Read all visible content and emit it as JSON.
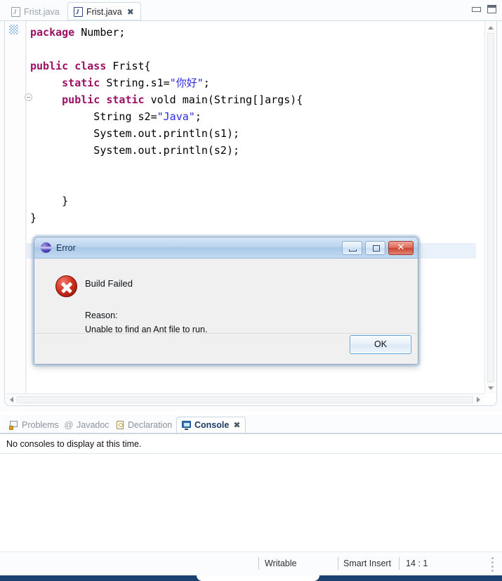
{
  "editor": {
    "tabs": [
      {
        "label": "Frist.java",
        "active": false,
        "icon": "java-file-icon"
      },
      {
        "label": "Frist.java",
        "active": true,
        "icon": "java-file-icon",
        "close": "✖"
      }
    ],
    "view_buttons": [
      {
        "name": "minimize-view",
        "icon": "minimize-icon"
      },
      {
        "name": "maximize-view",
        "icon": "maximize-icon"
      }
    ],
    "code_lines": [
      [
        {
          "t": "package ",
          "c": "kw"
        },
        {
          "t": "Number;",
          "c": "plain"
        }
      ],
      [
        {
          "t": "",
          "c": "plain"
        }
      ],
      [
        {
          "t": "public class ",
          "c": "kw"
        },
        {
          "t": "Frist{",
          "c": "plain"
        }
      ],
      [
        {
          "t": "     ",
          "c": "plain"
        },
        {
          "t": "static ",
          "c": "kw"
        },
        {
          "t": "String.s1=",
          "c": "plain"
        },
        {
          "t": "\"你好\"",
          "c": "str"
        },
        {
          "t": ";",
          "c": "plain"
        }
      ],
      [
        {
          "t": "     ",
          "c": "plain"
        },
        {
          "t": "public static ",
          "c": "kw"
        },
        {
          "t": "vold main(String[]args){",
          "c": "plain"
        }
      ],
      [
        {
          "t": "          String s2=",
          "c": "plain"
        },
        {
          "t": "\"Java\"",
          "c": "str"
        },
        {
          "t": ";",
          "c": "plain"
        }
      ],
      [
        {
          "t": "          System.out.println(s1);",
          "c": "plain"
        }
      ],
      [
        {
          "t": "          System.out.println(s2);",
          "c": "plain"
        }
      ],
      [
        {
          "t": "",
          "c": "plain"
        }
      ],
      [
        {
          "t": "",
          "c": "plain"
        }
      ],
      [
        {
          "t": "     }",
          "c": "plain"
        }
      ],
      [
        {
          "t": "}",
          "c": "plain"
        }
      ]
    ],
    "colors": {
      "keyword": "#9c1063",
      "string": "#2a2ae0",
      "text": "#000000",
      "current_line": "#e9f1fb"
    }
  },
  "dialog": {
    "title": "Error",
    "icon": "eclipse-sphere-icon",
    "heading": "Build Failed",
    "reason_label": "Reason:",
    "reason_text": "Unable to find an Ant file to run.",
    "ok_label": "OK",
    "window_buttons": [
      {
        "name": "minimize-button",
        "icon": "minimize-icon"
      },
      {
        "name": "restore-button",
        "icon": "restore-icon"
      },
      {
        "name": "close-button",
        "icon": "close-icon",
        "glyph": "✕"
      }
    ],
    "error_icon": "error-circle-icon"
  },
  "bottom_panel": {
    "tabs": [
      {
        "label": "Problems",
        "active": false,
        "icon": "problems-icon"
      },
      {
        "label": "Javadoc",
        "active": false,
        "icon": "javadoc-at-icon"
      },
      {
        "label": "Declaration",
        "active": false,
        "icon": "declaration-icon"
      },
      {
        "label": "Console",
        "active": true,
        "icon": "console-monitor-icon",
        "close": "✖"
      }
    ],
    "console_message": "No consoles to display at this time."
  },
  "status_bar": {
    "writable": "Writable",
    "insert_mode": "Smart Insert",
    "position": "14 : 1"
  }
}
